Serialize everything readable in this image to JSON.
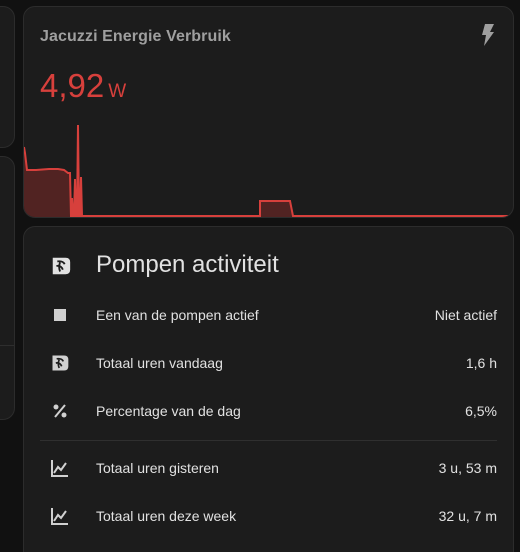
{
  "energy_card": {
    "title": "Jacuzzi Energie Verbruik",
    "value": "4,92",
    "unit": "W",
    "icon": "flash-icon",
    "accent": "#d7403c"
  },
  "pumps_card": {
    "title": "Pompen activiteit",
    "icon": "pump-icon",
    "rows": [
      {
        "label": "Een van de pompen actief",
        "value": "Niet actief",
        "icon": "square-icon"
      },
      {
        "label": "Totaal uren vandaag",
        "value": "1,6 h",
        "icon": "pump-icon"
      },
      {
        "label": "Percentage van de dag",
        "value": "6,5%",
        "icon": "percent-icon"
      },
      {
        "label": "Totaal uren gisteren",
        "value": "3 u, 53 m",
        "icon": "chart-line-icon"
      },
      {
        "label": "Totaal uren deze week",
        "value": "32 u, 7 m",
        "icon": "chart-line-icon"
      }
    ]
  }
}
